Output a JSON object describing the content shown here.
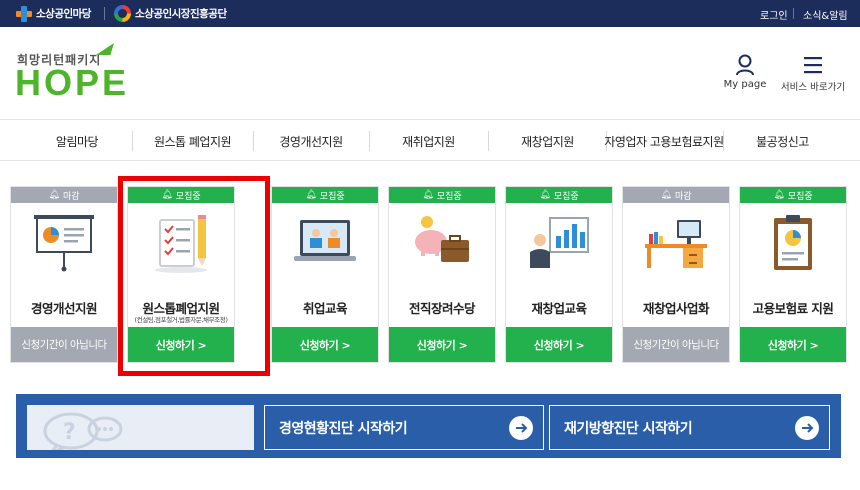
{
  "topbar": {
    "brand1": "소상공인마당",
    "brand2": "소상공인시장진흥공단",
    "login": "로그인",
    "news": "소식&알림"
  },
  "header": {
    "tagline": "희망리턴패키지",
    "logo": "HOPE",
    "mypage": "My page",
    "service": "서비스 바로가기"
  },
  "nav": {
    "items": [
      "알림마당",
      "원스톱 폐업지원",
      "경영개선지원",
      "재취업지원",
      "재창업지원",
      "자영업자 고용보험료지원",
      "불공정신고"
    ]
  },
  "cards": [
    {
      "badge": "마감",
      "status": "closed",
      "title": "경영개선지원",
      "sub": "",
      "action": "신청기간이 아닙니다",
      "icon": "presentation-board-icon"
    },
    {
      "badge": "모집중",
      "status": "open",
      "title": "원스톱폐업지원",
      "sub": "(컨설팅,점포철거,법률자문,채무조정)",
      "action": "신청하기 >",
      "icon": "checklist-clipboard-icon"
    },
    {
      "badge": "모집중",
      "status": "open",
      "title": "취업교육",
      "sub": "",
      "action": "신청하기 >",
      "icon": "laptop-video-icon"
    },
    {
      "badge": "모집중",
      "status": "open",
      "title": "전직장려수당",
      "sub": "",
      "action": "신청하기 >",
      "icon": "piggybank-briefcase-icon"
    },
    {
      "badge": "모집중",
      "status": "open",
      "title": "재창업교육",
      "sub": "",
      "action": "신청하기 >",
      "icon": "presenter-chart-icon"
    },
    {
      "badge": "마감",
      "status": "closed",
      "title": "재창업사업화",
      "sub": "",
      "action": "신청기간이 아닙니다",
      "icon": "desk-computer-icon"
    },
    {
      "badge": "모집중",
      "status": "open",
      "title": "고용보험료 지원",
      "sub": "",
      "action": "신청하기 >",
      "icon": "clipboard-piechart-icon"
    }
  ],
  "banner": {
    "btn1": "경영현황진단 시작하기",
    "btn2": "재기방향진단 시작하기"
  },
  "colors": {
    "topbar": "#1c2c5b",
    "green": "#22b14c",
    "closed": "#a3a8b2",
    "banner": "#2a5ea8",
    "highlight": "#ee0000",
    "logo_green": "#4db52a"
  }
}
